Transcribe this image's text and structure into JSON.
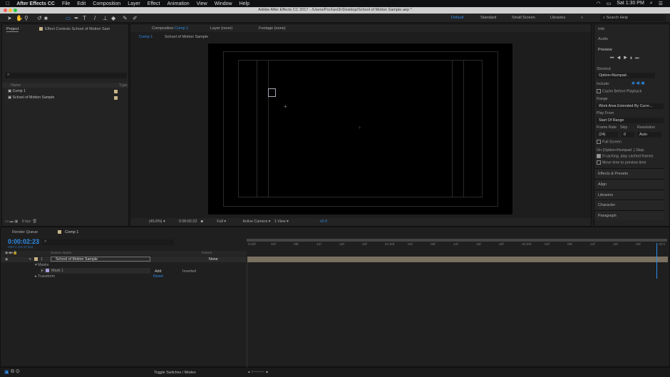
{
  "menubar": {
    "app": "After Effects CC",
    "items": [
      "File",
      "Edit",
      "Composition",
      "Layer",
      "Effect",
      "Animation",
      "View",
      "Window",
      "Help"
    ],
    "clock": "Sat 1:30 PM"
  },
  "window_title": "Adobe After Effects CC 2017 - /Users/ProXavi3r/Desktop/School of Motion Sample.aep *",
  "workspaces": {
    "items": [
      "Default",
      "Standard",
      "Small Screen",
      "Libraries"
    ],
    "active": "Default",
    "search_placeholder": "Search Help"
  },
  "project": {
    "tab": "Project",
    "effect_controls_tab": "Effect Controls School of Motion Sam",
    "columns": {
      "name": "Name",
      "type": "Type"
    },
    "items": [
      {
        "name": "Comp 1"
      },
      {
        "name": "School of Motion Sample"
      }
    ],
    "bpc": "8 bpc"
  },
  "composition": {
    "tab_prefix": "Composition",
    "tab_name": "Comp 1",
    "layer_tab": "Layer (none)",
    "footage_tab": "Footage (none)",
    "breadcrumb": [
      "Comp 1",
      "School of Motion Sample"
    ],
    "zoom": "(45.6%)",
    "timecode": "0:00:02:23",
    "resolution": "Full",
    "camera": "Active Camera",
    "views": "1 View",
    "exposure": "+0.0"
  },
  "right_panel": {
    "info": "Info",
    "audio": "Audio",
    "preview": "Preview",
    "shortcut_label": "Shortcut",
    "shortcut": "Option+Numpad .",
    "include_label": "Include:",
    "cache_before_playback": "Cache Before Playback",
    "range_label": "Range",
    "range": "Work Area Extended By Curre...",
    "play_from_label": "Play From",
    "play_from": "Start Of Range",
    "frame_rate_label": "Frame Rate",
    "skip_label": "Skip",
    "resolution_label": "Resolution",
    "frame_rate": "(24)",
    "skip": "0",
    "resolution": "Auto",
    "full_screen": "Full Screen",
    "stop_label": "On (Option+Numpad .) Stop:",
    "if_caching": "If caching, play cached frames",
    "move_time": "Move time to preview time",
    "sections": [
      "Effects & Presets",
      "Align",
      "Libraries",
      "Character",
      "Paragraph"
    ]
  },
  "timeline": {
    "render_queue": "Render Queue",
    "comp_tab": "Comp 1",
    "timecode": "0:00:02:23",
    "frame_info": "00071 (24.00 fps)",
    "col_source": "Source Name",
    "col_parent": "Parent",
    "layer": {
      "num": "1",
      "name": "School of Motion Sample",
      "parent": "None"
    },
    "masks": "Masks",
    "mask1": "Mask 1",
    "mask_mode": "Add",
    "inverted": "Inverted",
    "transform": "Transform",
    "reset": "Reset",
    "ruler": [
      "0:00f",
      "04f",
      "08f",
      "12f",
      "16f",
      "20f",
      "01:00f",
      "04f",
      "08f",
      "12f",
      "16f",
      "20f",
      "02:00f",
      "04f",
      "08f",
      "12f",
      "16f",
      "20f",
      "03:0"
    ],
    "toggle": "Toggle Switches / Modes"
  }
}
